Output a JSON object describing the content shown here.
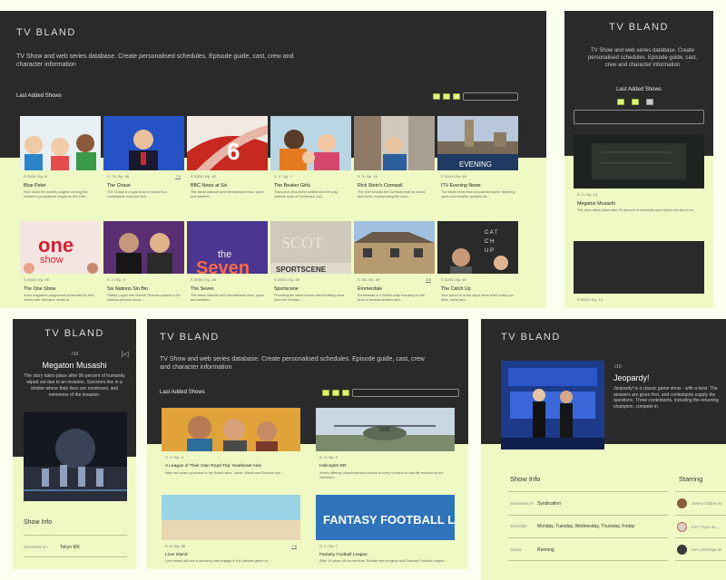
{
  "brand": "TV BLAND",
  "tagline": "TV Show and web series database. Create personalised schedules. Episode guide, cast, crew and character information",
  "section_title": "Last Added Shows",
  "panel1": {
    "cards": [
      {
        "meta": "© 2023 / Ep. 8",
        "rating": "",
        "title": "Blue Peter",
        "summary": "Ever since the world's longest running live children's programme began on the 16th..."
      },
      {
        "meta": "S. 73 / Ep. 36",
        "rating": "7.9",
        "title": "The Chase",
        "summary": "The Chase is a quiz show in which four contestants must put their ..."
      },
      {
        "meta": "© 2023 / Ep. 40",
        "rating": "",
        "title": "BBC News at Six",
        "summary": "The latest national and international news, sport and weather..."
      },
      {
        "meta": "S. 2 / Ep. 7",
        "rating": "",
        "title": "The Beaker Girls",
        "summary": "Tracy and Jess seem settled into the cosy seaside town of Cookesea, but..."
      },
      {
        "meta": "S. 3 / Ep. 10",
        "rating": "",
        "title": "Rick Stein's Cornwall",
        "summary": "The chef reveals the Cornwall that he knows and loves, championing the food..."
      },
      {
        "meta": "© 2023 / Ep. 40",
        "rating": "",
        "title": "ITV Evening News",
        "summary": "The latest news from around the world, featuring sport and weather updates as..."
      },
      {
        "meta": "© 2023 / Ep. 39",
        "rating": "",
        "title": "The One Show",
        "summary": "A live magazine programme presented by Alex Jones with Jermaine Jenas or ..."
      },
      {
        "meta": "S. 1 / Ep. 3",
        "rating": "",
        "title": "Six Nations Sin Bin",
        "summary": "Gabby Logan and Gareth Thomas present a Six Nations preview show ..."
      },
      {
        "meta": "© 2023 / Ep. 26",
        "rating": "",
        "title": "The Seven",
        "summary": "The latest national and international news, sport and weather..."
      },
      {
        "meta": "© 2023 / Ep. 35",
        "rating": "",
        "title": "Sportscene",
        "summary": "Providing the latest scores and breaking news from the Scottish ..."
      },
      {
        "meta": "S. 54 / Ep. 40",
        "rating": "5.9",
        "title": "Emmerdale",
        "summary": "Emmerdale is a British soap focusing on the lives of several families and..."
      },
      {
        "meta": "© 2023 / Ep. 40",
        "rating": "",
        "title": "The Catch Up",
        "summary": "Your quick hit of the day's news that'll make you think, smile and..."
      }
    ]
  },
  "panel2": {
    "cards": [
      {
        "meta": "S. 2 / Ep. 14",
        "title": "Megaton Musashi",
        "summary": "The story takes place after 90 percent of humanity were wiped out due to an ..."
      },
      {
        "meta": "© 2023 / Ep. 13",
        "title": "",
        "summary": ""
      }
    ]
  },
  "panel3": {
    "rating": "-/10",
    "title": "Megaton Musashi",
    "summary": "The story takes place after 90 percent of humanity wiped out due to an invasion. Survivors live in a shelter where their lives are monitored, and memories of the invasion.",
    "info_heading": "Show Info",
    "info_label": "Streamed on",
    "info_value": "Tokyo MX"
  },
  "panel4": {
    "cards": [
      {
        "meta": "S. 1 / Ep. 2",
        "rating": "",
        "title": "A League of Their Own Road Trip: Southeast Asia",
        "summary": "After two years grounded to the British isles, Jamie, Micah and Romesh are..."
      },
      {
        "meta": "S. 4 / Ep. 4",
        "rating": "",
        "title": "Helicopter ER",
        "summary": "Series offering unprecedented access to every moment of real-life rescues by the Yorkshire..."
      },
      {
        "meta": "S. 9 / Ep. 35",
        "rating": "7.8",
        "title": "Love Island",
        "summary": "Love Island will see a stunning cast engage in the ultimate game of..."
      },
      {
        "meta": "S. 1 / Ep. 7",
        "rating": "",
        "title": "Fantasy Football League",
        "summary": "After 19 years off our screens, Baddiel are bringing back Fantasy Football League..."
      }
    ]
  },
  "panel5": {
    "rating": "-/10",
    "title": "Jeopardy!",
    "summary": "Jeopardy! is a classic game show - with a twist. The answers are given first, and contestants supply the questions. Three contestants, including the returning champion, compete in",
    "info_heading": "Show Info",
    "starring_heading": "Starring",
    "info_rows": [
      {
        "label": "Streamed on",
        "value": "Syndication"
      },
      {
        "label": "Schedule",
        "value": "Monday, Tuesday, Wednesday, Thursday, Friday"
      },
      {
        "label": "Status",
        "value": "Running"
      }
    ],
    "cast": [
      "Jimmy Gilbert as",
      "Ken Tryon as ...",
      "Ken Jennings as"
    ]
  },
  "colors": {
    "dark": "#2b2a2a",
    "light": "#eef9c4",
    "accent": "#dff27a",
    "background": "#fbfff0"
  }
}
